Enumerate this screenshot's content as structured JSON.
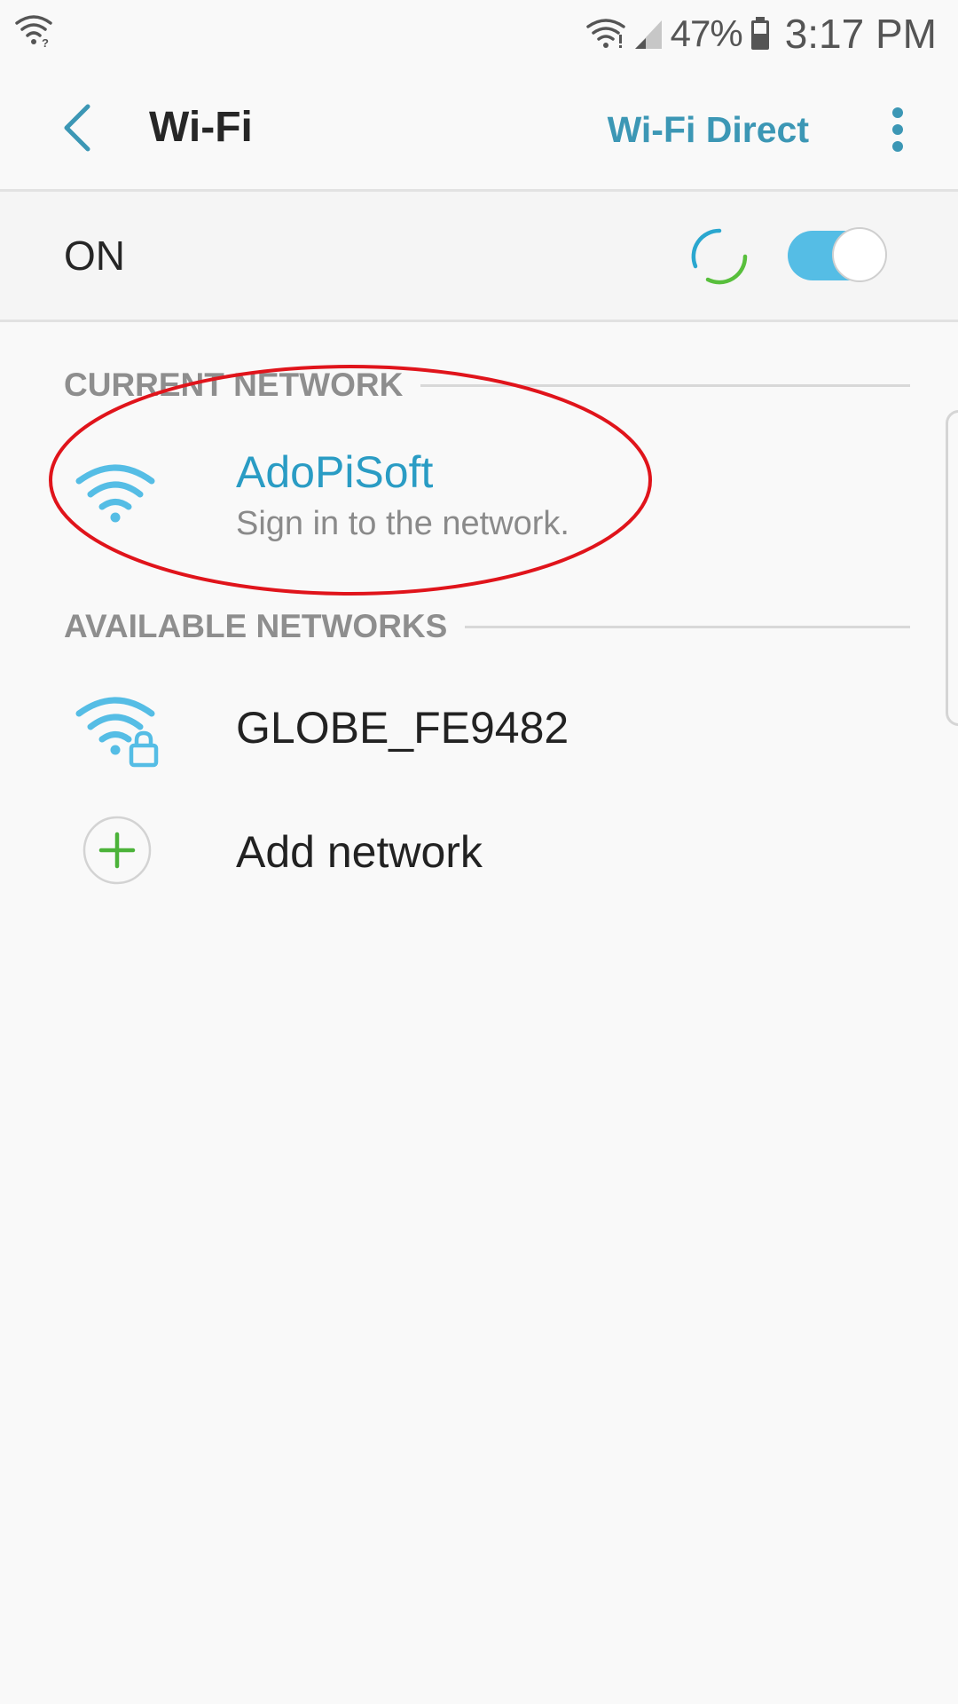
{
  "status_bar": {
    "battery_percent": "47%",
    "time": "3:17 PM",
    "icons": [
      "wifi-question-icon",
      "wifi-icon",
      "signal-icon",
      "battery-icon"
    ]
  },
  "app_bar": {
    "title": "Wi-Fi",
    "wifi_direct_label": "Wi-Fi Direct",
    "back_icon": "chevron-left-icon",
    "more_icon": "more-vert-icon"
  },
  "wifi_switch": {
    "label": "ON",
    "state": true,
    "accent_color": "#55bde5"
  },
  "current_network": {
    "header": "CURRENT NETWORK",
    "name": "AdoPiSoft",
    "status": "Sign in to the network.",
    "icon": "wifi-icon",
    "name_color": "#2a9cc4"
  },
  "available_networks": {
    "header": "AVAILABLE NETWORKS",
    "items": [
      {
        "name": "GLOBE_FE9482",
        "icon": "wifi-lock-icon"
      }
    ]
  },
  "add_network": {
    "label": "Add network",
    "icon": "plus-icon"
  },
  "annotation_color": "#e0141b"
}
